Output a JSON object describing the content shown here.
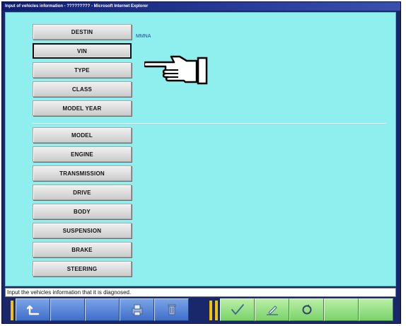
{
  "window": {
    "title": "Input of vehicles information - ????????? - Microsoft Internet Explorer"
  },
  "vehicle_info": {
    "buttons": [
      {
        "key": "destin",
        "label": "DESTIN",
        "selected": false
      },
      {
        "key": "vin",
        "label": "VIN",
        "selected": true
      },
      {
        "key": "type",
        "label": "TYPE",
        "selected": false
      },
      {
        "key": "class",
        "label": "CLASS",
        "selected": false
      },
      {
        "key": "model_year",
        "label": "MODEL YEAR",
        "selected": false
      },
      {
        "key": "model",
        "label": "MODEL",
        "selected": false
      },
      {
        "key": "engine",
        "label": "ENGINE",
        "selected": false
      },
      {
        "key": "transmission",
        "label": "TRANSMISSION",
        "selected": false
      },
      {
        "key": "drive",
        "label": "DRIVE",
        "selected": false
      },
      {
        "key": "body",
        "label": "BODY",
        "selected": false
      },
      {
        "key": "suspension",
        "label": "SUSPENSION",
        "selected": false
      },
      {
        "key": "brake",
        "label": "BRAKE",
        "selected": false
      },
      {
        "key": "steering",
        "label": "STEERING",
        "selected": false
      }
    ],
    "destin_value": "MMNA"
  },
  "pointer_icon": "pointing-hand-icon",
  "status": {
    "message": "Input the vehicles information that it is diagnosed."
  },
  "toolbar": {
    "left_buttons": [
      {
        "icon": "return-arrow-icon"
      },
      {
        "icon": ""
      },
      {
        "icon": ""
      },
      {
        "icon": "print-icon"
      },
      {
        "icon": "delete-icon"
      }
    ],
    "right_buttons": [
      {
        "icon": "checkmark-icon"
      },
      {
        "icon": "edit-icon"
      },
      {
        "icon": "refresh-icon"
      },
      {
        "icon": ""
      },
      {
        "icon": ""
      }
    ]
  },
  "colors": {
    "content_bg": "#8feeee",
    "toolbar_blue": "#3f6fc9",
    "toolbar_green": "#7ad26a",
    "divider_yellow": "#f2c300"
  }
}
